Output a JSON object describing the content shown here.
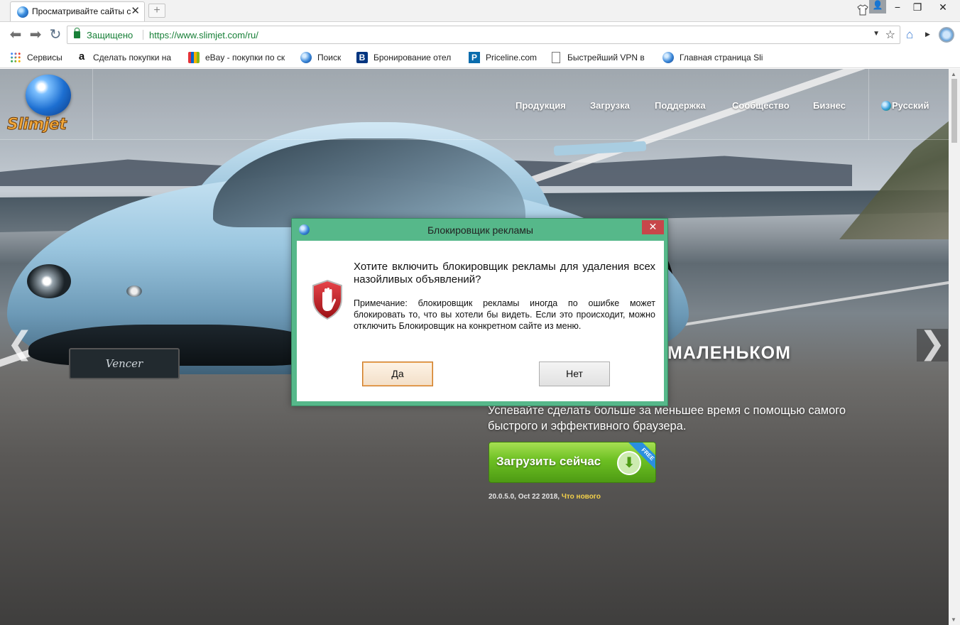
{
  "browser": {
    "tab_title": "Просматривайте сайты с",
    "tab_close": "✕",
    "new_tab": "+",
    "window": {
      "minimize": "−",
      "maximize": "❐",
      "close": "✕"
    },
    "nav": {
      "back": "⬅",
      "forward": "➡",
      "reload": "↻"
    },
    "address": {
      "secure_label": "Защищено",
      "url": "https://www.slimjet.com/ru/"
    }
  },
  "bookmarks": [
    {
      "icon": "apps-icon",
      "label": "Сервисы"
    },
    {
      "icon": "amazon-icon",
      "label": "Сделать покупки на"
    },
    {
      "icon": "ebay-icon",
      "label": "eBay - покупки по ск"
    },
    {
      "icon": "globe-icon",
      "label": "Поиск"
    },
    {
      "icon": "booking-icon",
      "label": "Бронирование отел"
    },
    {
      "icon": "priceline-icon",
      "label": "Priceline.com"
    },
    {
      "icon": "document-icon",
      "label": "Быстрейший VPN в"
    },
    {
      "icon": "globe-icon",
      "label": "Главная страница Sli"
    }
  ],
  "site": {
    "logo_text": "Slimjet",
    "nav": [
      "Продукция",
      "Загрузка",
      "Поддержка",
      "Сообщество",
      "Бизнес"
    ],
    "language": "Русский",
    "hero_title": "МАЛЕНЬКОМ",
    "hero_subtitle": "Успевайте сделать больше за меньшее время с помощью самого быстрого и эффективного браузера.",
    "download_label": "Загрузить сейчас",
    "free_ribbon": "FREE",
    "version_info": "20.0.5.0, Oct 22 2018, ",
    "whats_new": "Что нового",
    "car_plate": "Vencer",
    "prev_arrow": "❮",
    "next_arrow": "❯"
  },
  "dialog": {
    "title": "Блокировщик рекламы",
    "close": "✕",
    "question": "Хотите включить блокировщик рекламы для удаления всех назойливых объявлений?",
    "note": "Примечание: блокировщик рекламы иногда по ошибке может блокировать то, что вы хотели бы видеть. Если это происходит, можно отключить Блокировщик на конкретном сайте из меню.",
    "yes": "Да",
    "no": "Нет"
  },
  "colors": {
    "dialog_frame": "#56b88a",
    "close_button": "#c7464a",
    "secure_green": "#188038",
    "download_green": "#6cbf22"
  }
}
